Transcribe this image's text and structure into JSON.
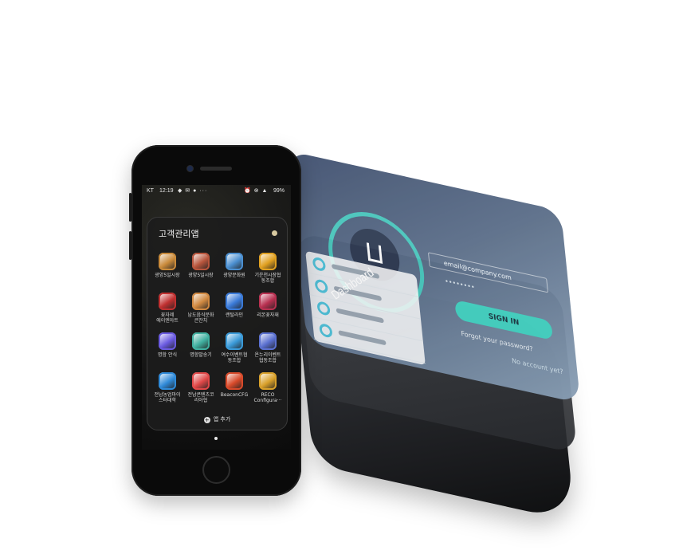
{
  "status_bar": {
    "carrier": "KT",
    "time": "12:19",
    "left_icons": "◆ ✉ ● ···",
    "right_icons": "⏰ ⊗ ▲",
    "battery": "99%"
  },
  "folder": {
    "title": "고객관리앱",
    "add_apps_label": "앱 추가",
    "apps": [
      {
        "label": "광양5일시장",
        "icon": "market-icon",
        "color": "#c98a3a"
      },
      {
        "label": "광양5일시장",
        "icon": "market-icon",
        "color": "#b8553c"
      },
      {
        "label": "광양문화원",
        "icon": "culture-icon",
        "color": "#4b8fd0"
      },
      {
        "label": "기운천시장협\n동조합",
        "icon": "sun-icon",
        "color": "#e0a020"
      },
      {
        "label": "꽃자제\n에이엔아트",
        "icon": "flower-icon",
        "color": "#c03030"
      },
      {
        "label": "남도음식문화\n큰잔치",
        "icon": "food-icon",
        "color": "#d08840"
      },
      {
        "label": "랜탈라인",
        "icon": "rental-icon",
        "color": "#3a7ad8"
      },
      {
        "label": "리본꽃자재",
        "icon": "ribbon-icon",
        "color": "#b83050"
      },
      {
        "label": "명함 안식",
        "icon": "card-icon",
        "color": "#6a5ae0"
      },
      {
        "label": "명함발송기",
        "icon": "send-icon",
        "color": "#40b0a0"
      },
      {
        "label": "여수이벤트협\n동조합",
        "icon": "event-icon",
        "color": "#3a9ad8"
      },
      {
        "label": "온누리이벤트\n협동조합",
        "icon": "event2-icon",
        "color": "#5a70d0"
      },
      {
        "label": "전남농업마이\n스터대학",
        "icon": "agri-icon",
        "color": "#2f8ad8"
      },
      {
        "label": "전남콘텐츠코\n리아협",
        "icon": "content-icon",
        "color": "#e04848"
      },
      {
        "label": "BeaconCFG",
        "icon": "beacon-icon",
        "color": "#d84a2a"
      },
      {
        "label": "RECO\nConfigura···",
        "icon": "reco-icon",
        "color": "#d8a02a"
      }
    ]
  },
  "app_layer": {
    "title": "Dashboard",
    "email_value": "email@company.com",
    "password_value": "••••••••",
    "sign_in_label": "SIGN IN",
    "forgot_label": "Forgot your password?",
    "no_account_label": "No account yet?"
  }
}
